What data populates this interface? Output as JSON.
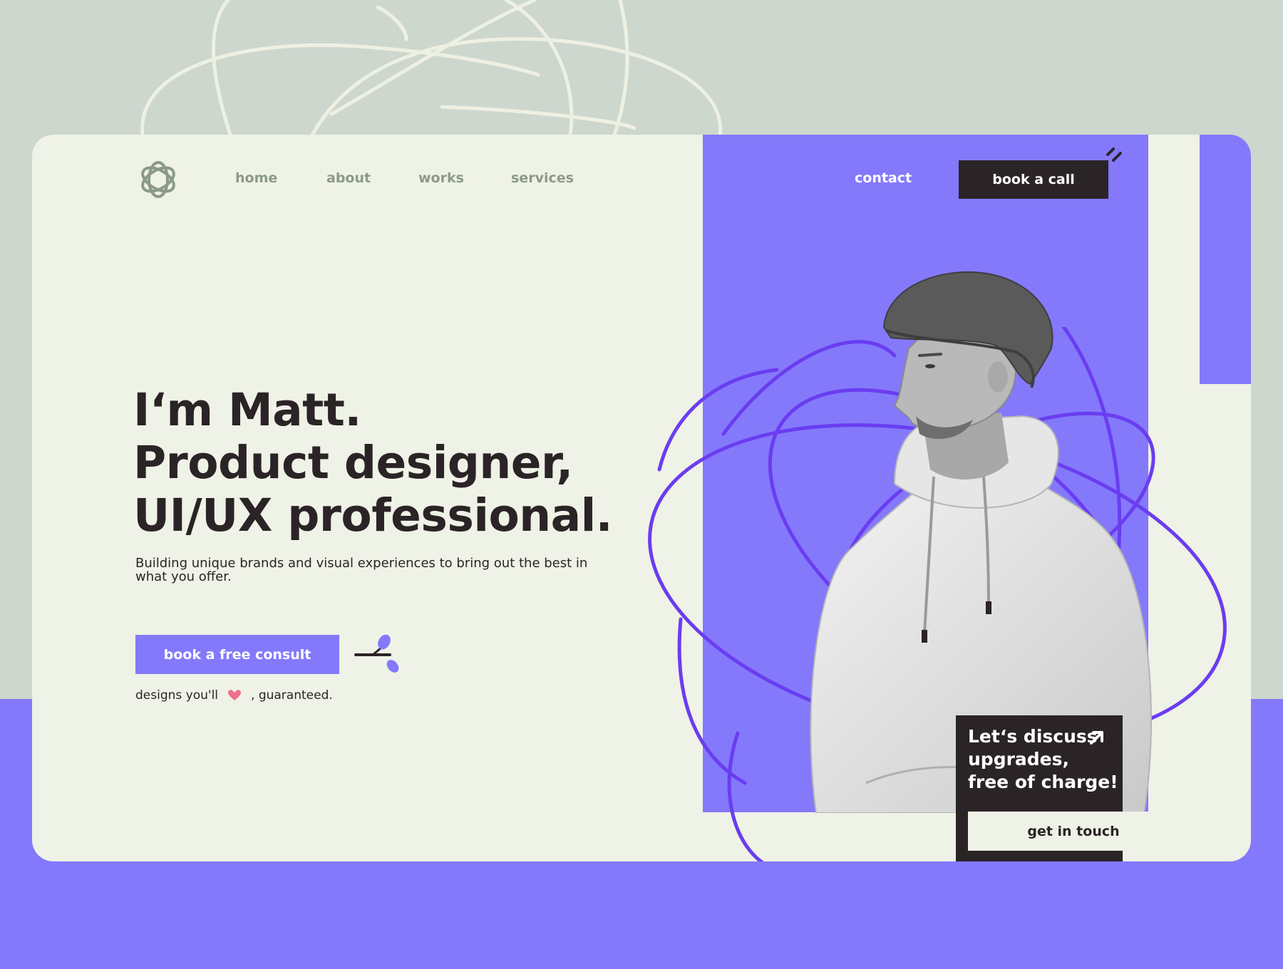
{
  "colors": {
    "accent": "#8479fb",
    "dark": "#2b2426",
    "cream": "#eff2e6",
    "sage": "#cdd7ce",
    "nav_muted": "#8b9a89",
    "orbit_line": "#6a3df0",
    "heart": "#f06e8a"
  },
  "header": {
    "logo_icon": "flower-knot-logo",
    "nav": [
      {
        "label": "home"
      },
      {
        "label": "about"
      },
      {
        "label": "works"
      },
      {
        "label": "services"
      }
    ],
    "contact_label": "contact",
    "book_call_label": "book a call"
  },
  "hero": {
    "title_lines": [
      "I‘m Matt.",
      "Product designer,",
      "UI/UX professional."
    ],
    "subtitle": "Building unique brands and visual experiences to bring out the best in what you offer.",
    "cta_label": "book a free consult",
    "guarantee_before": "designs you'll",
    "guarantee_icon": "heart-icon",
    "guarantee_after": ", guaranteed."
  },
  "promo": {
    "lines": [
      "Let‘s discuss",
      "upgrades,",
      "free of charge!"
    ],
    "arrow_icon": "arrow-up-right-icon",
    "button_label": "get in touch"
  },
  "portrait": {
    "subject": "man in beanie and white hoodie, grayscale photo"
  }
}
